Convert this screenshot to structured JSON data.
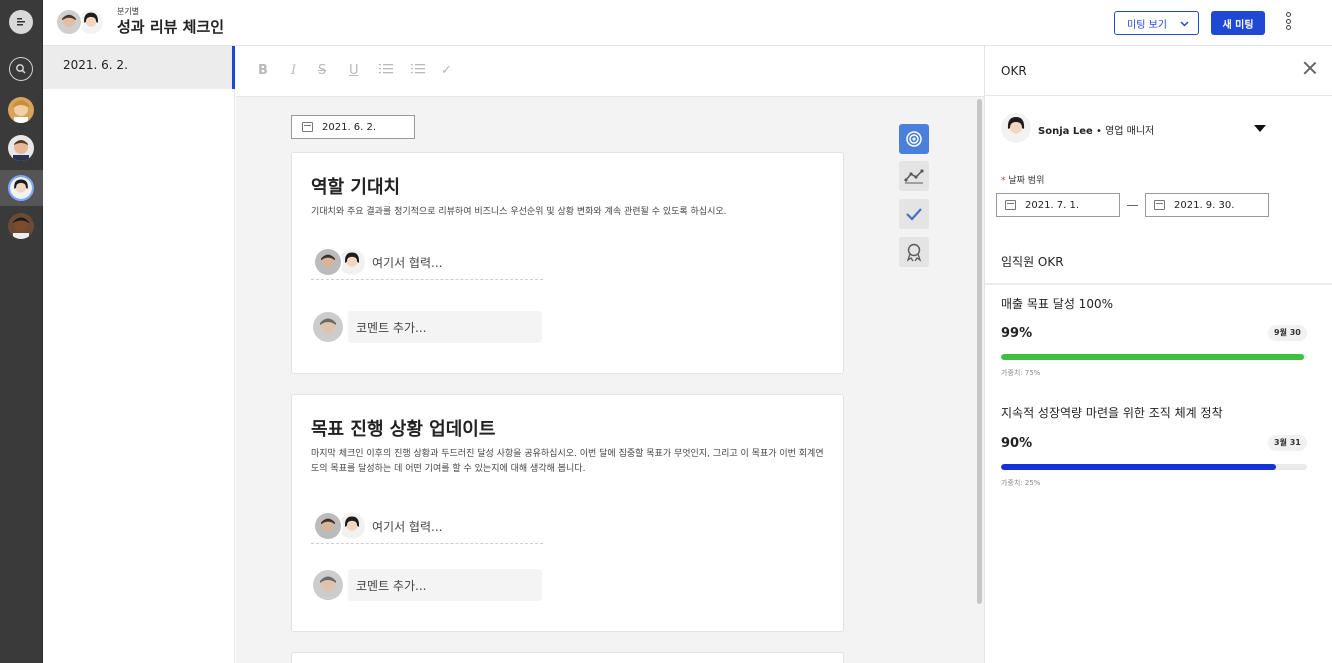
{
  "header": {
    "subtitle": "분기별",
    "title": "성과 리뷰 체크인",
    "meeting_view_label": "미팅 보기",
    "new_meeting_label": "새 미팅"
  },
  "sidebar_dates": [
    {
      "label": "2021. 6. 2."
    }
  ],
  "toolbar": {
    "bold": "B",
    "italic": "I",
    "strike": "S",
    "underline": "U",
    "check": "✓"
  },
  "editor": {
    "date_value": "2021. 6. 2.",
    "sections": [
      {
        "title": "역할 기대치",
        "description": "기대치와 주요 결과를 정기적으로 리뷰하여 비즈니스 우선순위 및 상황 변화와 계속 관련될 수 있도록 하십시오.",
        "collab_label": "여기서 협력...",
        "comment_placeholder": "코멘트 추가..."
      },
      {
        "title": "목표 진행 상황 업데이트",
        "description": "마지막 체크인 이후의 진행 상황과 두드러진 달성 사항을 공유하십시오. 이번 달에 집중할 목표가 무엇인지, 그리고 이 목표가 이번 회계연도의 목표를 달성하는 데 어떤 기여를 할 수 있는지에 대해 생각해 봅니다.",
        "collab_label": "여기서 협력...",
        "comment_placeholder": "코멘트 추가..."
      }
    ]
  },
  "okr_panel": {
    "title": "OKR",
    "user_name": "Sonja Lee",
    "user_role": "영업 매니저",
    "date_range_label": "날짜 범위",
    "date_start": "2021. 7. 1.",
    "date_end": "2021. 9. 30.",
    "section_label": "임직원 OKR",
    "objectives": [
      {
        "title": "매출 목표 달성 100%",
        "percent": "99%",
        "progress": 0.99,
        "due": "9월 30",
        "weight": "가중치: 75%",
        "color": "#3fbf3f"
      },
      {
        "title": "지속적 성장역량 마련을 위한 조직 체계 정착",
        "percent": "90%",
        "progress": 0.9,
        "due": "3월 31",
        "weight": "가중치: 25%",
        "color": "#1432d6"
      }
    ]
  },
  "colors": {
    "accent": "#1f48d4",
    "rail": "#3a3a3a",
    "tool_active": "#4a7fdb"
  },
  "icons": {
    "rail_menu": "list-icon",
    "rail_search": "search-icon",
    "tools": [
      "target-icon",
      "trend-icon",
      "check-icon",
      "award-icon"
    ]
  }
}
